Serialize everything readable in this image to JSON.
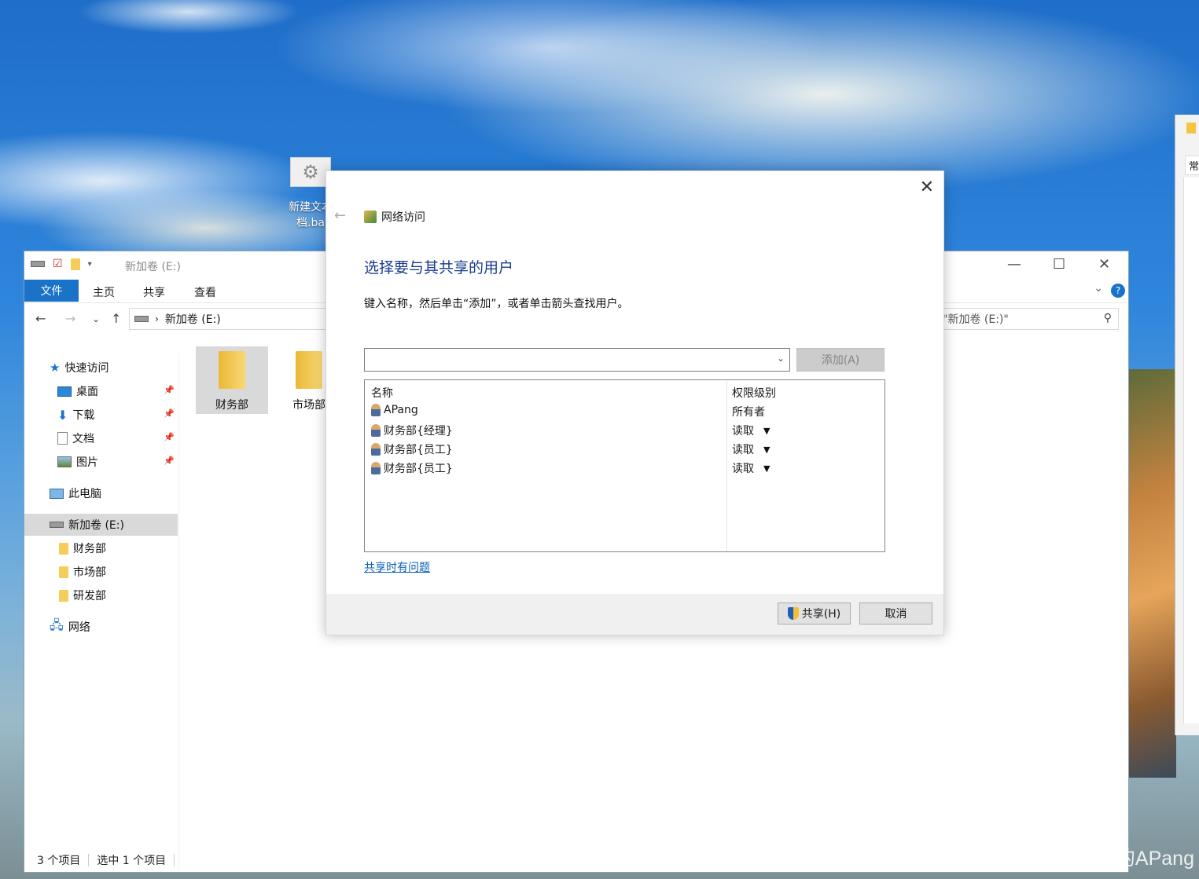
{
  "desktop": {
    "icon_label": "新建文本\n档.ba"
  },
  "explorer": {
    "title": "新加卷 (E:)",
    "ribbon": {
      "file": "文件",
      "home": "主页",
      "share": "共享",
      "view": "查看"
    },
    "address": "新加卷 (E:)",
    "search_placeholder": "索\"新加卷 (E:)\"",
    "nav": {
      "quick_access": "快速访问",
      "desktop": "桌面",
      "downloads": "下载",
      "documents": "文档",
      "pictures": "图片",
      "this_pc": "此电脑",
      "drive": "新加卷 (E:)",
      "folder1": "财务部",
      "folder2": "市场部",
      "folder3": "研发部",
      "network": "网络"
    },
    "items": [
      {
        "name": "财务部"
      },
      {
        "name": "市场部"
      }
    ],
    "status": {
      "count": "3 个项目",
      "selected": "选中 1 个项目"
    }
  },
  "dialog": {
    "header": "网络访问",
    "title": "选择要与其共享的用户",
    "instruction": "键入名称，然后单击“添加”，或者单击箭头查找用户。",
    "name_input_value": "",
    "add_button": "添加(A)",
    "columns": {
      "name": "名称",
      "permission": "权限级别"
    },
    "rows": [
      {
        "name": "APang",
        "permission": "所有者"
      },
      {
        "name": "财务部{经理}",
        "permission": "读取"
      },
      {
        "name": "财务部{员工}",
        "permission": "读取"
      },
      {
        "name": "财务部{员工}",
        "permission": "读取"
      }
    ],
    "help_link": "共享时有问题",
    "share_button": "共享(H)",
    "cancel_button": "取消"
  },
  "right_window": {
    "tab": "常"
  },
  "watermark": "CSDN @学网络的APang"
}
